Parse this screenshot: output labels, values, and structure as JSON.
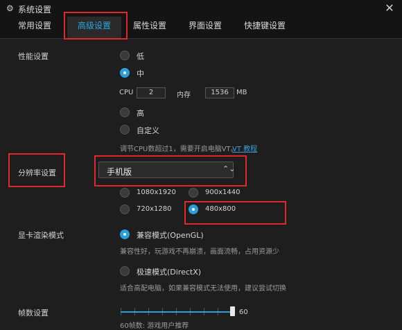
{
  "window": {
    "title": "系统设置",
    "icon": "gear-icon",
    "close_icon": "close-icon",
    "close_glyph": "✕"
  },
  "tabs": [
    {
      "label": "常用设置",
      "active": false
    },
    {
      "label": "高级设置",
      "active": true
    },
    {
      "label": "属性设置",
      "active": false
    },
    {
      "label": "界面设置",
      "active": false
    },
    {
      "label": "快捷键设置",
      "active": false
    }
  ],
  "performance": {
    "label": "性能设置",
    "options": [
      {
        "label": "低",
        "selected": false
      },
      {
        "label": "中",
        "selected": true
      },
      {
        "label": "高",
        "selected": false
      },
      {
        "label": "自定义",
        "selected": false
      }
    ],
    "cpu_label": "CPU",
    "cpu_value": "2",
    "mem_label": "内存",
    "mem_value": "1536",
    "mem_unit": "MB",
    "hint": "调节CPU数超过1，需要开启电脑VT。",
    "hint_link": "VT 教程"
  },
  "resolution": {
    "label": "分辨率设置",
    "select_value": "手机版",
    "options": [
      {
        "label": "1080x1920",
        "selected": false
      },
      {
        "label": "900x1440",
        "selected": false
      },
      {
        "label": "720x1280",
        "selected": false
      },
      {
        "label": "480x800",
        "selected": true
      }
    ]
  },
  "render": {
    "label": "显卡渲染模式",
    "options": [
      {
        "label": "兼容模式(OpenGL)",
        "selected": true,
        "desc": "兼容性好，玩游戏不再崩溃，画面流畅，占用资源少"
      },
      {
        "label": "极速模式(DirectX)",
        "selected": false,
        "desc": "适合高配电脑，如果兼容模式无法使用，建议尝试切换"
      }
    ]
  },
  "fps": {
    "label": "帧数设置",
    "value": "60",
    "max": 60,
    "hint": "60帧数: 游戏用户推荐"
  },
  "colors": {
    "accent": "#2a9fd8",
    "highlight": "#e0282e",
    "background": "#1e1e1e"
  }
}
